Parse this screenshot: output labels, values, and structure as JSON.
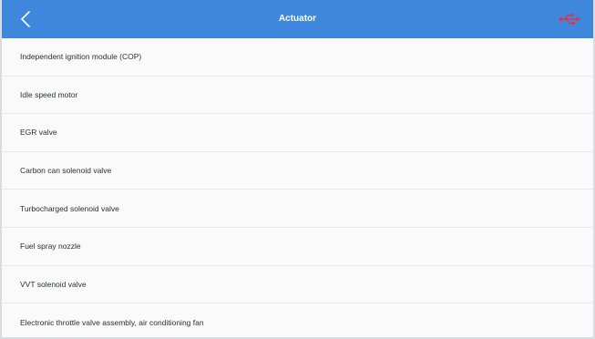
{
  "header": {
    "title": "Actuator",
    "back_icon": "chevron-left-icon",
    "status_icon": "usb-icon",
    "background_color": "#3f86dd",
    "status_icon_color": "#e8323a"
  },
  "actuator_list": {
    "items": [
      {
        "label": "Independent ignition module (COP)"
      },
      {
        "label": "Idle speed motor"
      },
      {
        "label": "EGR valve"
      },
      {
        "label": "Carbon can solenoid valve"
      },
      {
        "label": "Turbocharged solenoid valve"
      },
      {
        "label": "Fuel spray nozzle"
      },
      {
        "label": "VVT solenoid valve"
      },
      {
        "label": "Electronic throttle valve assembly, air conditioning fan"
      }
    ]
  }
}
